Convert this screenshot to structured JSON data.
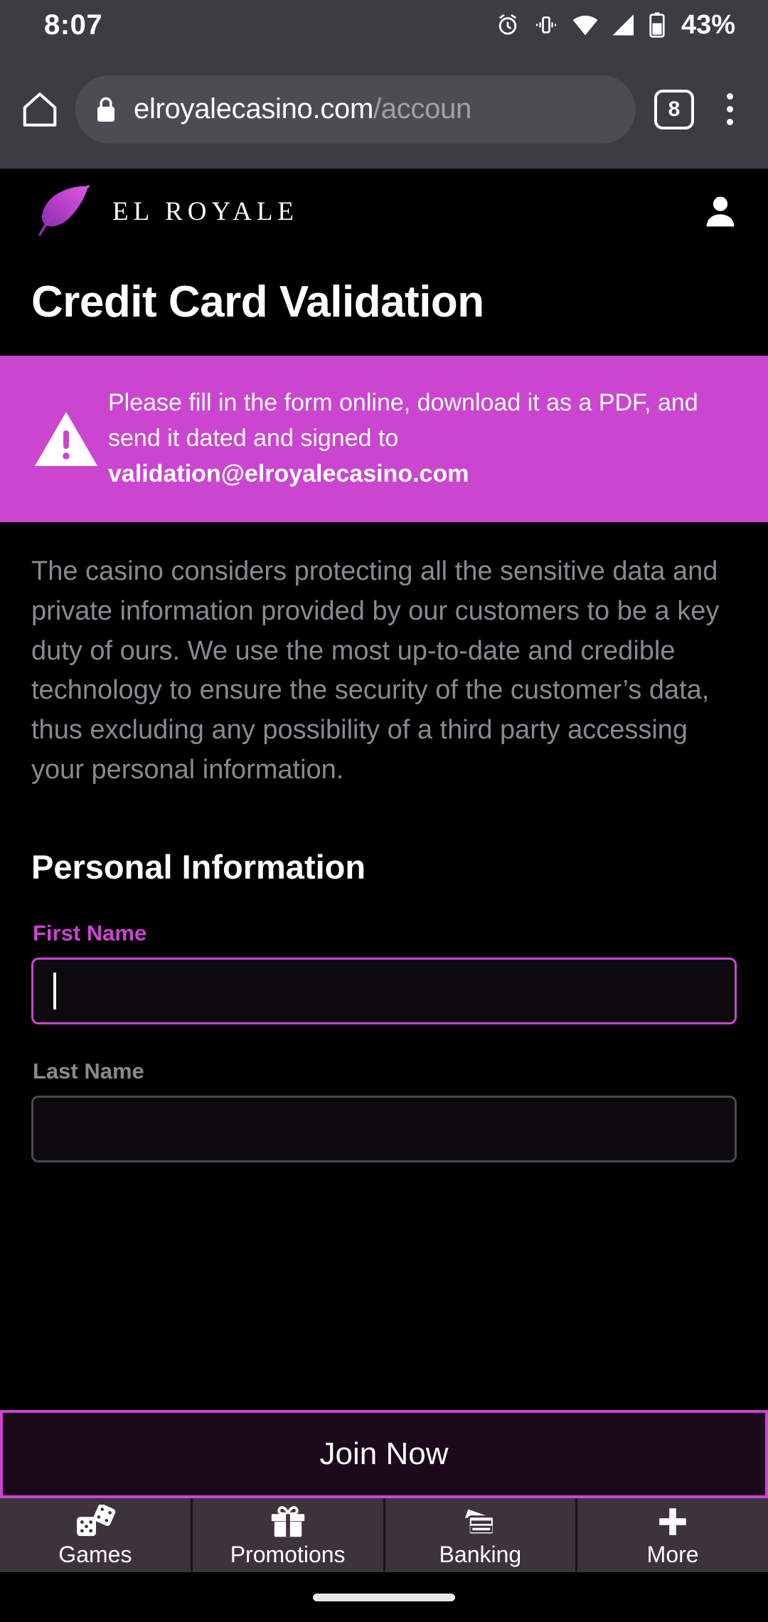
{
  "status_bar": {
    "time": "8:07",
    "battery_percent": "43%",
    "icons": [
      "alarm-icon",
      "vibrate-icon",
      "wifi-icon",
      "cellular-signal-icon",
      "battery-icon"
    ]
  },
  "browser": {
    "home_icon": "home-icon",
    "lock_icon": "lock-icon",
    "url_domain": "elroyalecasino.com",
    "url_path": "/accoun",
    "tab_count": "8",
    "menu_icon": "overflow-menu-icon"
  },
  "site_header": {
    "logo_icon": "feather-logo-icon",
    "brand_name": "EL ROYALE",
    "account_icon": "account-person-icon"
  },
  "page": {
    "title": "Credit Card Validation"
  },
  "alert": {
    "icon": "warning-triangle-icon",
    "line1": "Please fill in the form online, download it as a PDF,",
    "line2": "and send it dated and signed to",
    "email": "validation@elroyalecasino.com"
  },
  "intro": {
    "paragraph": "The casino considers protecting all the sensitive data and private information provided by our customers to be a key duty of ours. We use the most up-to-date and credible technology to ensure the security of the customer’s data, thus excluding any possibility of a third party accessing your personal information."
  },
  "form": {
    "section_title": "Personal Information",
    "fields": [
      {
        "label": "First Name",
        "value": "",
        "placeholder": "",
        "state": "focused"
      },
      {
        "label": "Last Name",
        "value": "",
        "placeholder": "",
        "state": "idle"
      }
    ]
  },
  "cta": {
    "join_label": "Join Now"
  },
  "bottom_nav": {
    "items": [
      {
        "label": "Games",
        "icon": "dice-icon"
      },
      {
        "label": "Promotions",
        "icon": "gift-icon"
      },
      {
        "label": "Banking",
        "icon": "credit-cards-icon"
      },
      {
        "label": "More",
        "icon": "plus-icon"
      }
    ]
  },
  "colors": {
    "accent_magenta": "#cb45d1",
    "page_background": "#000000",
    "chrome_background": "#3a3d41",
    "nav_background": "#3d333c",
    "body_text": "#8c8790",
    "cta_fill": "#1b0a1c"
  }
}
